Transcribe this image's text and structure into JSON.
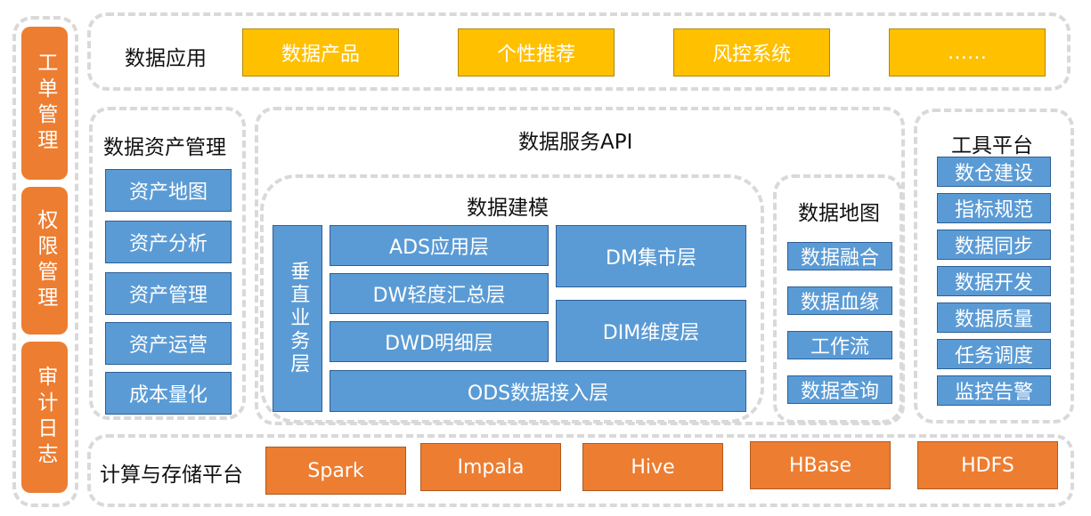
{
  "sidebar": [
    {
      "label": "工单管理"
    },
    {
      "label": "权限管理"
    },
    {
      "label": "审计日志"
    }
  ],
  "data_application": {
    "title": "数据应用",
    "items": [
      "数据产品",
      "个性推荐",
      "风控系统",
      "……"
    ]
  },
  "data_asset_management": {
    "title": "数据资产管理",
    "items": [
      "资产地图",
      "资产分析",
      "资产管理",
      "资产运营",
      "成本量化"
    ]
  },
  "data_service_api": {
    "title": "数据服务API"
  },
  "data_modeling": {
    "title": "数据建模",
    "vertical_layer": "垂直业务层",
    "ads": "ADS应用层",
    "dw": "DW轻度汇总层",
    "dwd": "DWD明细层",
    "ods": "ODS数据接入层",
    "dm": "DM集市层",
    "dim": "DIM维度层"
  },
  "data_map": {
    "title": "数据地图",
    "items": [
      "数据融合",
      "数据血缘",
      "工作流",
      "数据查询"
    ]
  },
  "tool_platform": {
    "title": "工具平台",
    "items": [
      "数仓建设",
      "指标规范",
      "数据同步",
      "数据开发",
      "数据质量",
      "任务调度",
      "监控告警"
    ]
  },
  "compute_storage": {
    "title": "计算与存储平台",
    "items": [
      "Spark",
      "Impala",
      "Hive",
      "HBase",
      "HDFS"
    ]
  },
  "colors": {
    "orange": "#ed7d31",
    "yellow": "#ffc000",
    "blue": "#5b9bd5",
    "frame": "#d9d9d9"
  }
}
